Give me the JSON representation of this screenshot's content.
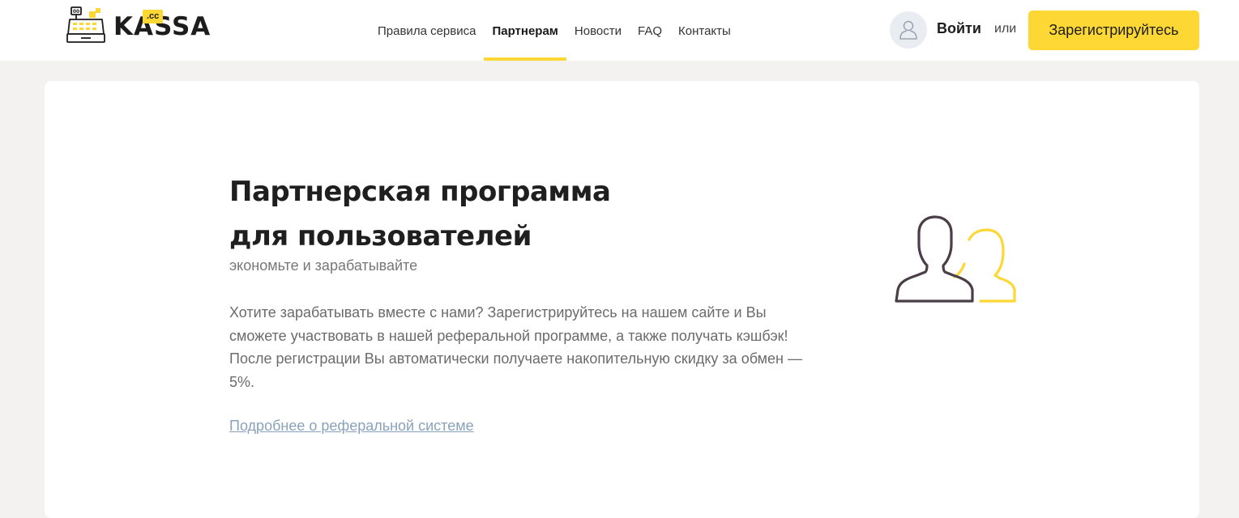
{
  "brand": {
    "name": "KASSA",
    "badge": ".cc"
  },
  "nav": {
    "items": [
      {
        "label": "Правила сервиса",
        "active": false
      },
      {
        "label": "Партнерам",
        "active": true
      },
      {
        "label": "Новости",
        "active": false
      },
      {
        "label": "FAQ",
        "active": false
      },
      {
        "label": "Контакты",
        "active": false
      }
    ]
  },
  "auth": {
    "avatar_icon": "user-outline-icon",
    "login_label": "Войти",
    "or_label": "или",
    "register_label": "Зарегистрируйтесь"
  },
  "main": {
    "title_line1": "Партнерская программа",
    "title_line2": "для пользователей",
    "subtitle": "экономьте и зарабатывайте",
    "description": "Хотите зарабатывать вместе с нами? Зарегистрируйтесь на нашем сайте и Вы сможете участвовать в нашей реферальной программе, а также получать кэшбэк! После регистрации Вы автоматически получаете накопительную скидку за обмен — 5%.",
    "more_link": "Подробнее о реферальной системе",
    "illustration_icon": "two-users-icon"
  },
  "colors": {
    "accent": "#fdd835",
    "page_background": "#f3f2f1",
    "link": "#8aa2bb",
    "illustration_dark": "#4a3f48"
  }
}
